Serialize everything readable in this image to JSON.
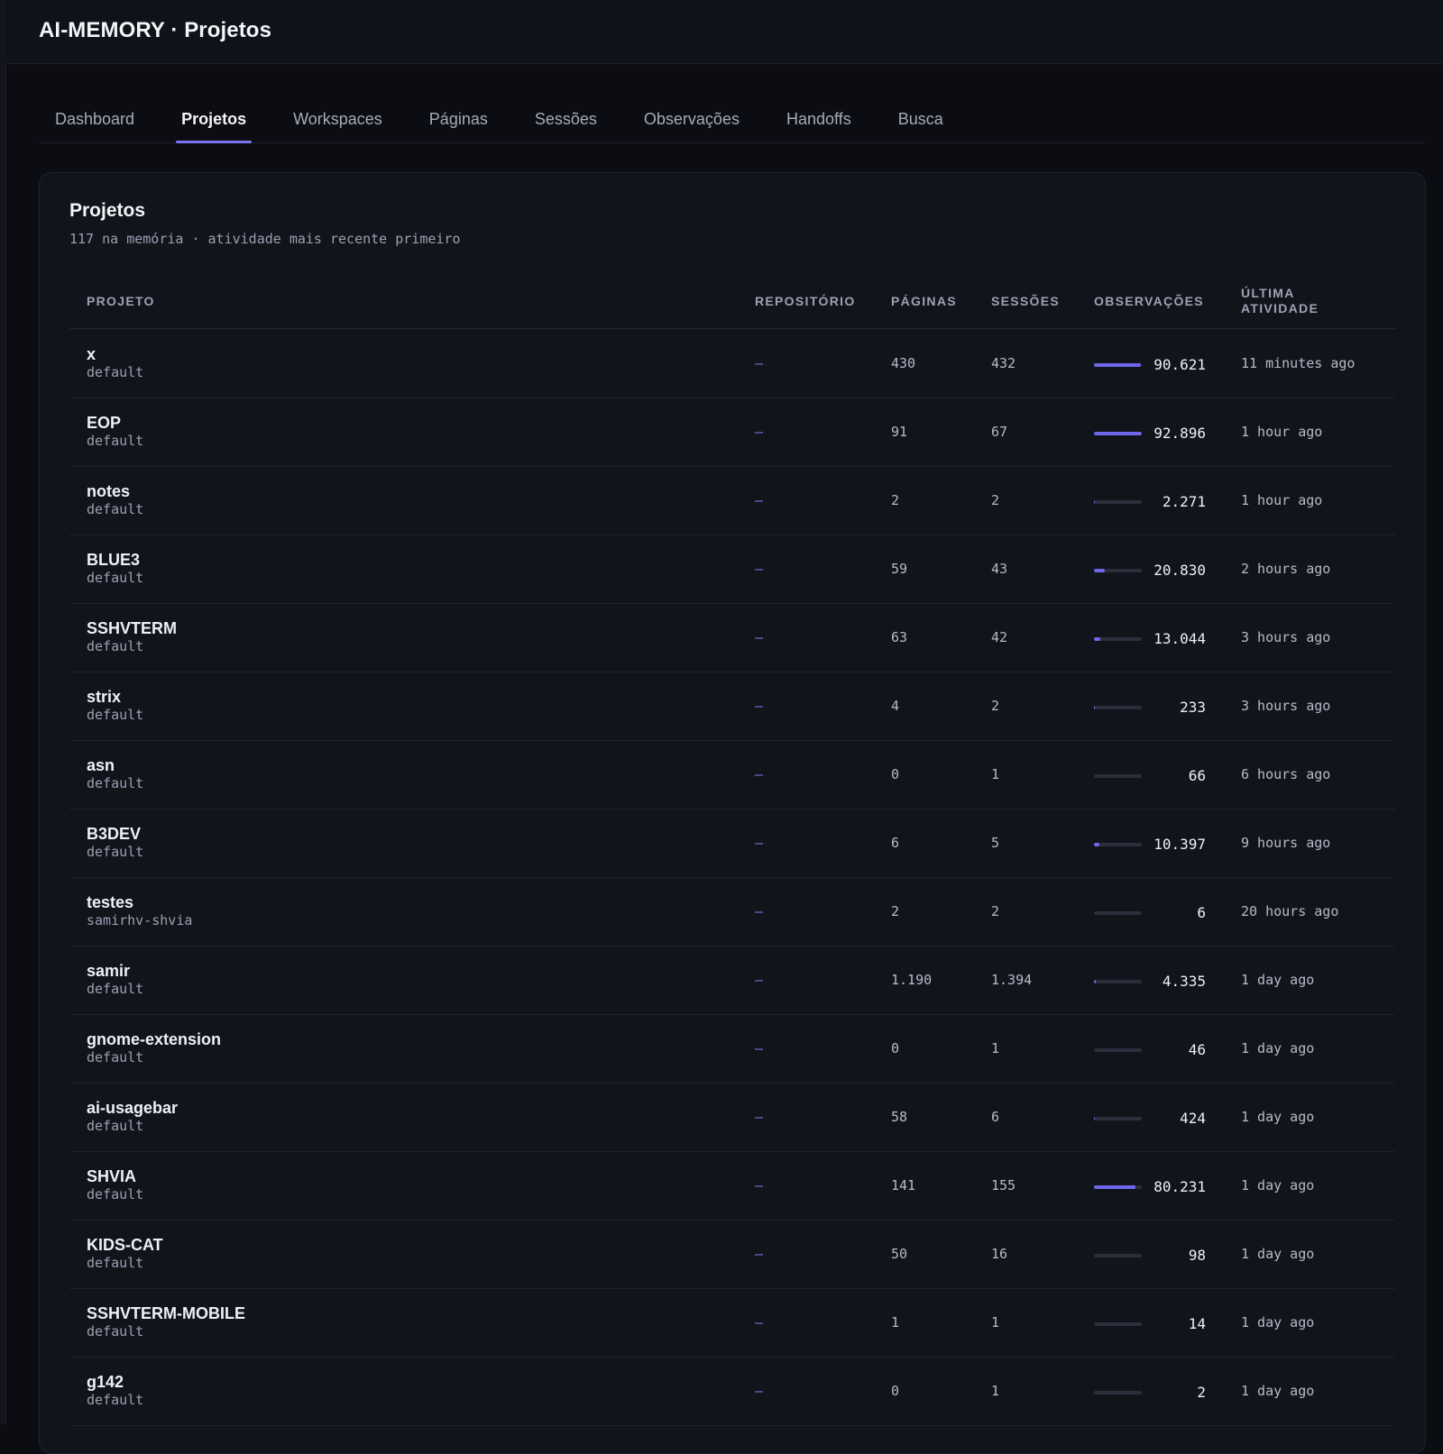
{
  "app": {
    "title": "AI-MEMORY · Projetos"
  },
  "tabs": [
    {
      "label": "Dashboard",
      "active": false
    },
    {
      "label": "Projetos",
      "active": true
    },
    {
      "label": "Workspaces",
      "active": false
    },
    {
      "label": "Páginas",
      "active": false
    },
    {
      "label": "Sessões",
      "active": false
    },
    {
      "label": "Observações",
      "active": false
    },
    {
      "label": "Handoffs",
      "active": false
    },
    {
      "label": "Busca",
      "active": false
    }
  ],
  "colors": {
    "accent": "#7b74f0",
    "bar_fill": "#6e67ec",
    "bar_track": "#2c2f3b",
    "background": "#0c0d13",
    "card": "#12141c"
  },
  "card": {
    "title": "Projetos",
    "subtitle": "117 na memória · atividade mais recente primeiro"
  },
  "table": {
    "columns": {
      "projeto": "PROJETO",
      "repositorio": "REPOSITÓRIO",
      "paginas": "PÁGINAS",
      "sessoes": "SESSÕES",
      "observacoes": "OBSERVAÇÕES",
      "ultima_atividade": "ÚLTIMA ATIVIDADE"
    },
    "rows": [
      {
        "name": "x",
        "workspace": "default",
        "repo": "—",
        "pages": "430",
        "sessions": "432",
        "obs": "90.621",
        "obs_fraction": 0.975,
        "last": "11 minutes ago"
      },
      {
        "name": "EOP",
        "workspace": "default",
        "repo": "—",
        "pages": "91",
        "sessions": "67",
        "obs": "92.896",
        "obs_fraction": 1.0,
        "last": "1 hour ago"
      },
      {
        "name": "notes",
        "workspace": "default",
        "repo": "—",
        "pages": "2",
        "sessions": "2",
        "obs": "2.271",
        "obs_fraction": 0.024,
        "last": "1 hour ago"
      },
      {
        "name": "BLUE3",
        "workspace": "default",
        "repo": "—",
        "pages": "59",
        "sessions": "43",
        "obs": "20.830",
        "obs_fraction": 0.224,
        "last": "2 hours ago"
      },
      {
        "name": "SSHVTERM",
        "workspace": "default",
        "repo": "—",
        "pages": "63",
        "sessions": "42",
        "obs": "13.044",
        "obs_fraction": 0.14,
        "last": "3 hours ago"
      },
      {
        "name": "strix",
        "workspace": "default",
        "repo": "—",
        "pages": "4",
        "sessions": "2",
        "obs": "233",
        "obs_fraction": 0.0025,
        "last": "3 hours ago"
      },
      {
        "name": "asn",
        "workspace": "default",
        "repo": "—",
        "pages": "0",
        "sessions": "1",
        "obs": "66",
        "obs_fraction": 0.0007,
        "last": "6 hours ago"
      },
      {
        "name": "B3DEV",
        "workspace": "default",
        "repo": "—",
        "pages": "6",
        "sessions": "5",
        "obs": "10.397",
        "obs_fraction": 0.112,
        "last": "9 hours ago"
      },
      {
        "name": "testes",
        "workspace": "samirhv-shvia",
        "repo": "—",
        "pages": "2",
        "sessions": "2",
        "obs": "6",
        "obs_fraction": 0.0001,
        "last": "20 hours ago"
      },
      {
        "name": "samir",
        "workspace": "default",
        "repo": "—",
        "pages": "1.190",
        "sessions": "1.394",
        "obs": "4.335",
        "obs_fraction": 0.047,
        "last": "1 day ago"
      },
      {
        "name": "gnome-extension",
        "workspace": "default",
        "repo": "—",
        "pages": "0",
        "sessions": "1",
        "obs": "46",
        "obs_fraction": 0.0005,
        "last": "1 day ago"
      },
      {
        "name": "ai-usagebar",
        "workspace": "default",
        "repo": "—",
        "pages": "58",
        "sessions": "6",
        "obs": "424",
        "obs_fraction": 0.0046,
        "last": "1 day ago"
      },
      {
        "name": "SHVIA",
        "workspace": "default",
        "repo": "—",
        "pages": "141",
        "sessions": "155",
        "obs": "80.231",
        "obs_fraction": 0.864,
        "last": "1 day ago"
      },
      {
        "name": "KIDS-CAT",
        "workspace": "default",
        "repo": "—",
        "pages": "50",
        "sessions": "16",
        "obs": "98",
        "obs_fraction": 0.001,
        "last": "1 day ago"
      },
      {
        "name": "SSHVTERM-MOBILE",
        "workspace": "default",
        "repo": "—",
        "pages": "1",
        "sessions": "1",
        "obs": "14",
        "obs_fraction": 0.0002,
        "last": "1 day ago"
      },
      {
        "name": "g142",
        "workspace": "default",
        "repo": "—",
        "pages": "0",
        "sessions": "1",
        "obs": "2",
        "obs_fraction": 2e-05,
        "last": "1 day ago"
      }
    ]
  }
}
